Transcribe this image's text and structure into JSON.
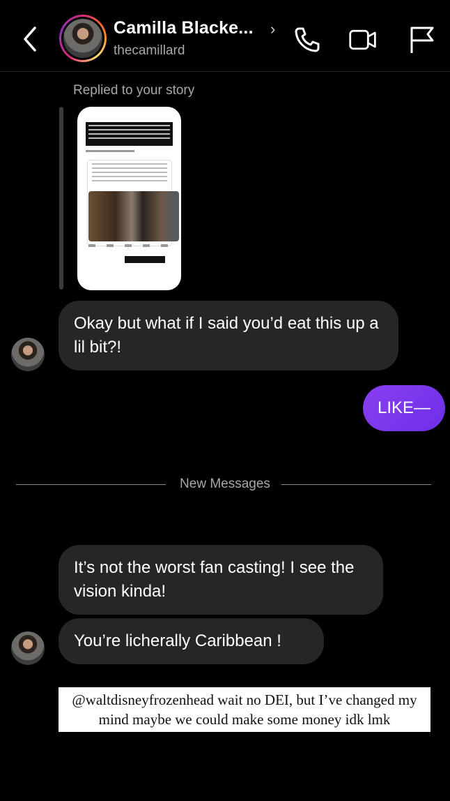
{
  "header": {
    "name": "Camilla Blacke...",
    "chevron": "›",
    "handle": "thecamillard",
    "icons": [
      "back-arrow-icon",
      "phone-icon",
      "video-camera-icon",
      "flag-icon"
    ]
  },
  "story": {
    "replied_label": "Replied to your story"
  },
  "messages": {
    "incoming_1": "Okay but what if I said you’d eat this up a lil bit?!",
    "outgoing_1": "LIKE—",
    "divider_label": "New Messages",
    "incoming_2": "It’s not the worst fan casting! I see the vision kinda!",
    "incoming_3": "You’re licherally Caribbean !"
  },
  "overlay_text": "@waltdisneyfrozenhead wait no DEI, but I’ve changed my mind maybe we could make some money idk lmk",
  "colors": {
    "background": "#000000",
    "incoming_bubble": "#262626",
    "outgoing_bubble": "#7c3aed",
    "secondary_text": "#a8a8a8"
  }
}
